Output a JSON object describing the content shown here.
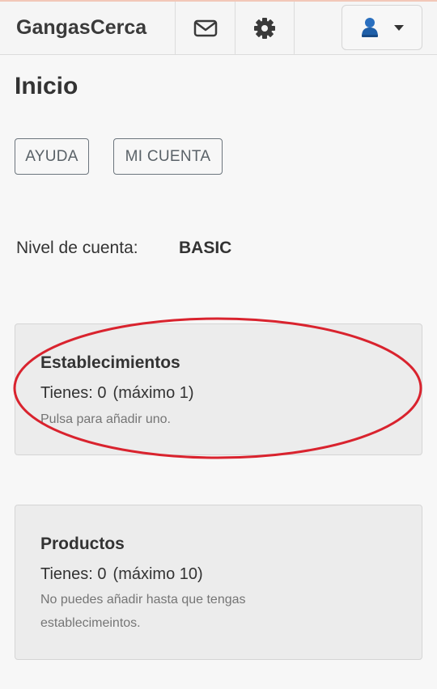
{
  "navbar": {
    "brand": "GangasCerca",
    "mail_icon": "envelope-icon",
    "settings_icon": "gear-icon",
    "user_icon": "user-icon"
  },
  "page": {
    "title": "Inicio"
  },
  "buttons": {
    "help": "AYUDA",
    "account": "MI CUENTA"
  },
  "account_level": {
    "label": "Nivel de cuenta:",
    "value": "BASIC"
  },
  "cards": {
    "establishments": {
      "title": "Establecimientos",
      "count": "Tienes: 0",
      "max": "(máximo 1)",
      "hint": "Pulsa para añadir uno."
    },
    "products": {
      "title": "Productos",
      "count": "Tienes: 0",
      "max": "(máximo 10)",
      "hint": "No puedes añadir hasta que tengas establecimeintos."
    }
  },
  "colors": {
    "annotation_ellipse": "#d9232e",
    "user_icon": "#1f5fa8",
    "top_accent": "#f2c7b8"
  }
}
